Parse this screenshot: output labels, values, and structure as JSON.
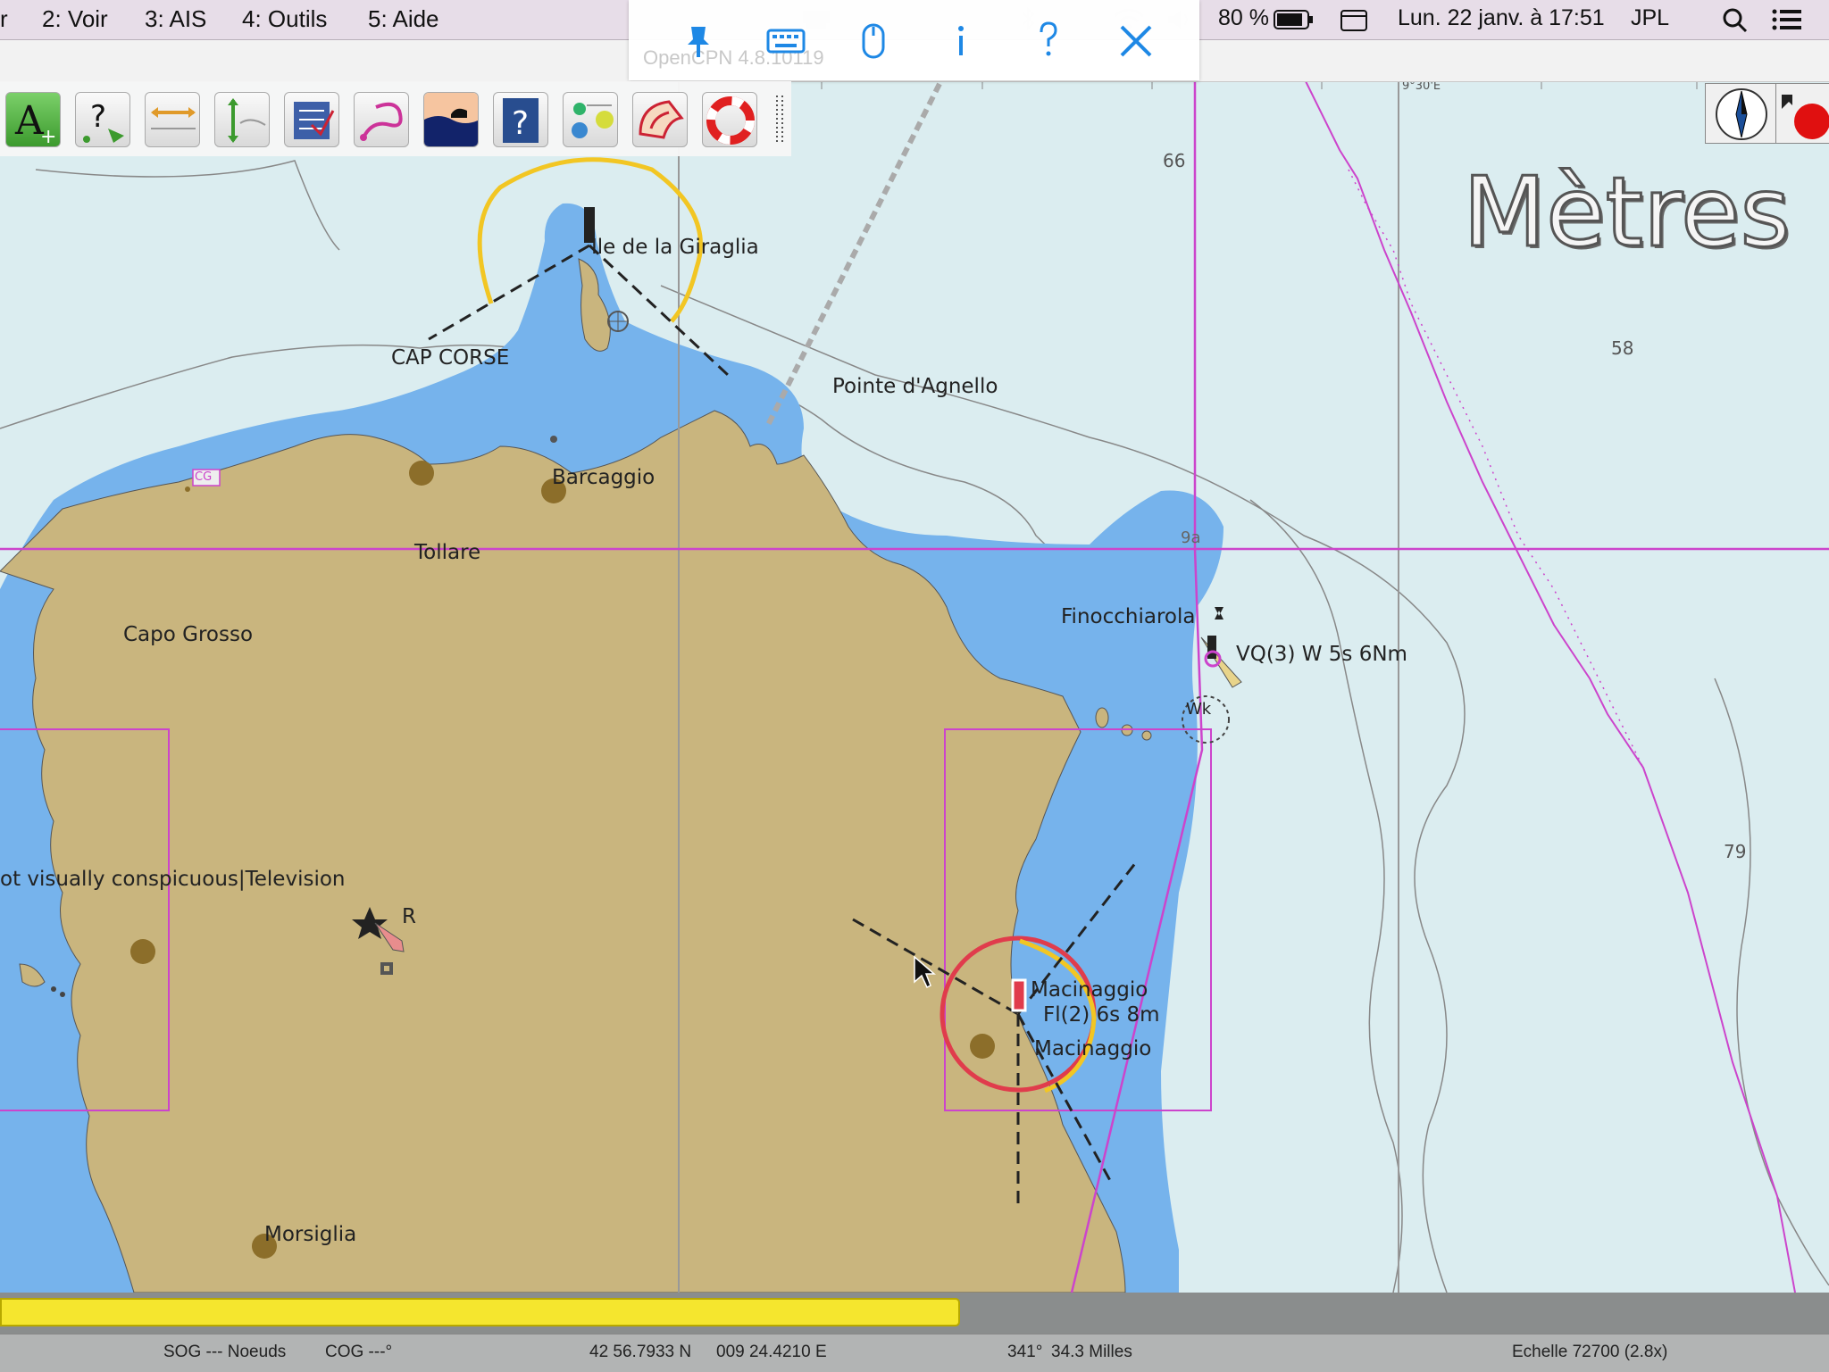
{
  "menubar": {
    "partial_item": "r",
    "items": [
      "2: Voir",
      "3: AIS",
      "4: Outils",
      "5: Aide"
    ],
    "battery": "80 %",
    "datetime": "Lun. 22 janv. à 17:51",
    "user": "JPL"
  },
  "app": {
    "title": "OpenCPN 4.8.10119"
  },
  "floating_toolbar": {
    "icons": [
      "pin-icon",
      "keyboard-icon",
      "mouse-icon",
      "info-icon",
      "help-icon",
      "close-icon"
    ]
  },
  "toolbar": {
    "tools": [
      "ais-targets-icon",
      "route-query-icon",
      "zoom-horizontal-icon",
      "zoom-vertical-icon",
      "route-manager-icon",
      "track-icon",
      "tide-current-icon",
      "chart-info-icon",
      "layers-icon",
      "dashboard-icon",
      "mob-icon"
    ]
  },
  "chart": {
    "units_overlay": "Mètres",
    "place_labels": {
      "giraglia": "Ile de la Giraglia",
      "cap_corse": "CAP CORSE",
      "pointe_agnello": "Pointe d'Agnello",
      "barcaggio": "Barcaggio",
      "tollare": "Tollare",
      "capo_grosso": "Capo Grosso",
      "finocchiarola": "Finocchiarola",
      "vq_light": "VQ(3) W 5s 6Nm",
      "conspicuous": "ot visually conspicuous|Television",
      "r_label": "R",
      "macinaggio_1": "Macinaggio",
      "fl_light": "Fl(2) 6s 8m",
      "macinaggio_2": "Macinaggio",
      "morsiglia": "Morsiglia",
      "cg": "CG",
      "wk": "Wk",
      "nine_a": "9a"
    },
    "depths": {
      "d66": "66",
      "d58": "58",
      "d79": "79"
    },
    "longitude_tick": "9°30'E"
  },
  "progress": {
    "value_fraction": 0.525,
    "color": "#f5e62e"
  },
  "statusbar": {
    "sog": "SOG --- Noeuds",
    "cog": "COG ---°",
    "lat": "42 56.7933 N",
    "lon": "009 24.4210 E",
    "bearing": "341°",
    "distance": "34.3 Milles",
    "scale": "Echelle 72700 (2.8x)"
  },
  "colors": {
    "land": "#c9b57e",
    "shallow": "#76b3ec",
    "deep": "#dbedf0",
    "route": "#cc44cc",
    "light_yellow": "#f2c623",
    "light_red": "#e03c4c"
  }
}
